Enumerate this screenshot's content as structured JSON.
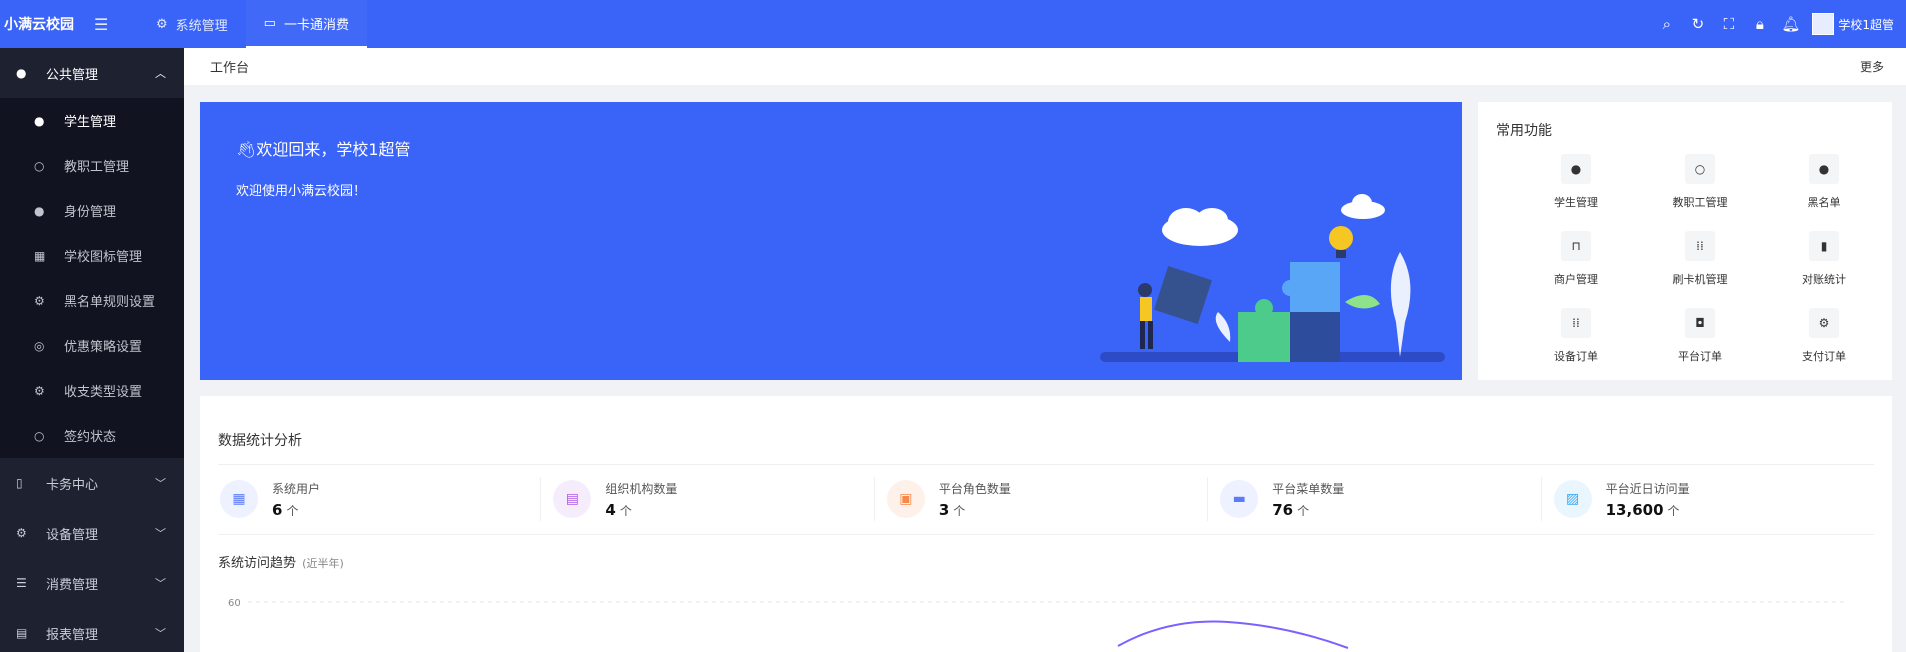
{
  "app": {
    "logo": "小满云校园",
    "menu_icon": "menu-fold-icon"
  },
  "topnav": [
    {
      "label": "系统管理",
      "icon": "gear-icon",
      "active": false
    },
    {
      "label": "一卡通消费",
      "icon": "card-icon",
      "active": true
    }
  ],
  "topright": {
    "icons": [
      "search-icon",
      "refresh-icon",
      "fullscreen-icon",
      "lock-icon",
      "bell-icon"
    ],
    "user": "学校1超管"
  },
  "sidebar": {
    "groups": [
      {
        "label": "公共管理",
        "icon": "user-icon",
        "open": true,
        "items": [
          {
            "label": "学生管理",
            "icon": "user-icon"
          },
          {
            "label": "教职工管理",
            "icon": "user-outline-icon"
          },
          {
            "label": "身份管理",
            "icon": "user-icon"
          },
          {
            "label": "学校图标管理",
            "icon": "building-icon"
          },
          {
            "label": "黑名单规则设置",
            "icon": "gear-icon"
          },
          {
            "label": "优惠策略设置",
            "icon": "discount-icon"
          },
          {
            "label": "收支类型设置",
            "icon": "gear-icon"
          },
          {
            "label": "签约状态",
            "icon": "user-outline-icon"
          }
        ]
      },
      {
        "label": "卡务中心",
        "icon": "card-icon"
      },
      {
        "label": "设备管理",
        "icon": "gear-icon"
      },
      {
        "label": "消费管理",
        "icon": "database-icon"
      },
      {
        "label": "报表管理",
        "icon": "report-icon"
      }
    ]
  },
  "breadcrumb": {
    "title": "工作台",
    "more": "更多"
  },
  "welcome": {
    "title": "欢迎回来，学校1超管",
    "subtitle": "欢迎使用小满云校园！",
    "wave_icon": "hand-wave-icon"
  },
  "quick": {
    "title": "常用功能",
    "items": [
      {
        "label": "学生管理",
        "icon": "user-icon"
      },
      {
        "label": "教职工管理",
        "icon": "user-outline-icon"
      },
      {
        "label": "黑名单",
        "icon": "user-icon"
      },
      {
        "label": "商户管理",
        "icon": "shop-bag-icon"
      },
      {
        "label": "刷卡机管理",
        "icon": "grid-icon"
      },
      {
        "label": "对账统计",
        "icon": "bar-chart-icon"
      },
      {
        "label": "设备订单",
        "icon": "grid-icon"
      },
      {
        "label": "平台订单",
        "icon": "order-icon"
      },
      {
        "label": "支付订单",
        "icon": "gear-icon"
      }
    ]
  },
  "stats": {
    "title": "数据统计分析",
    "metrics": [
      {
        "label": "系统用户",
        "value": "6",
        "unit": "个",
        "icon": "apps-icon",
        "color": "#5b7cfa",
        "bg": "#eef1ff"
      },
      {
        "label": "组织机构数量",
        "value": "4",
        "unit": "个",
        "icon": "org-icon",
        "color": "#b15ce8",
        "bg": "#f5edfc"
      },
      {
        "label": "平台角色数量",
        "value": "3",
        "unit": "个",
        "icon": "role-icon",
        "color": "#f5894b",
        "bg": "#fef1e9"
      },
      {
        "label": "平台菜单数量",
        "value": "76",
        "unit": "个",
        "icon": "menu-list-icon",
        "color": "#5b7cfa",
        "bg": "#eef1ff"
      },
      {
        "label": "平台近日访问量",
        "value": "13,600",
        "unit": "个",
        "icon": "trend-image-icon",
        "color": "#3aa8f0",
        "bg": "#eaf6fe"
      }
    ],
    "trend_title": "系统访问趋势",
    "trend_sub": "(近半年)"
  },
  "chart_data": {
    "type": "line",
    "title": "系统访问趋势",
    "subtitle": "(近半年)",
    "y_ticks": [
      60
    ],
    "ylim": [
      0,
      60
    ],
    "grid": true,
    "series_color": "#7b61ff"
  }
}
